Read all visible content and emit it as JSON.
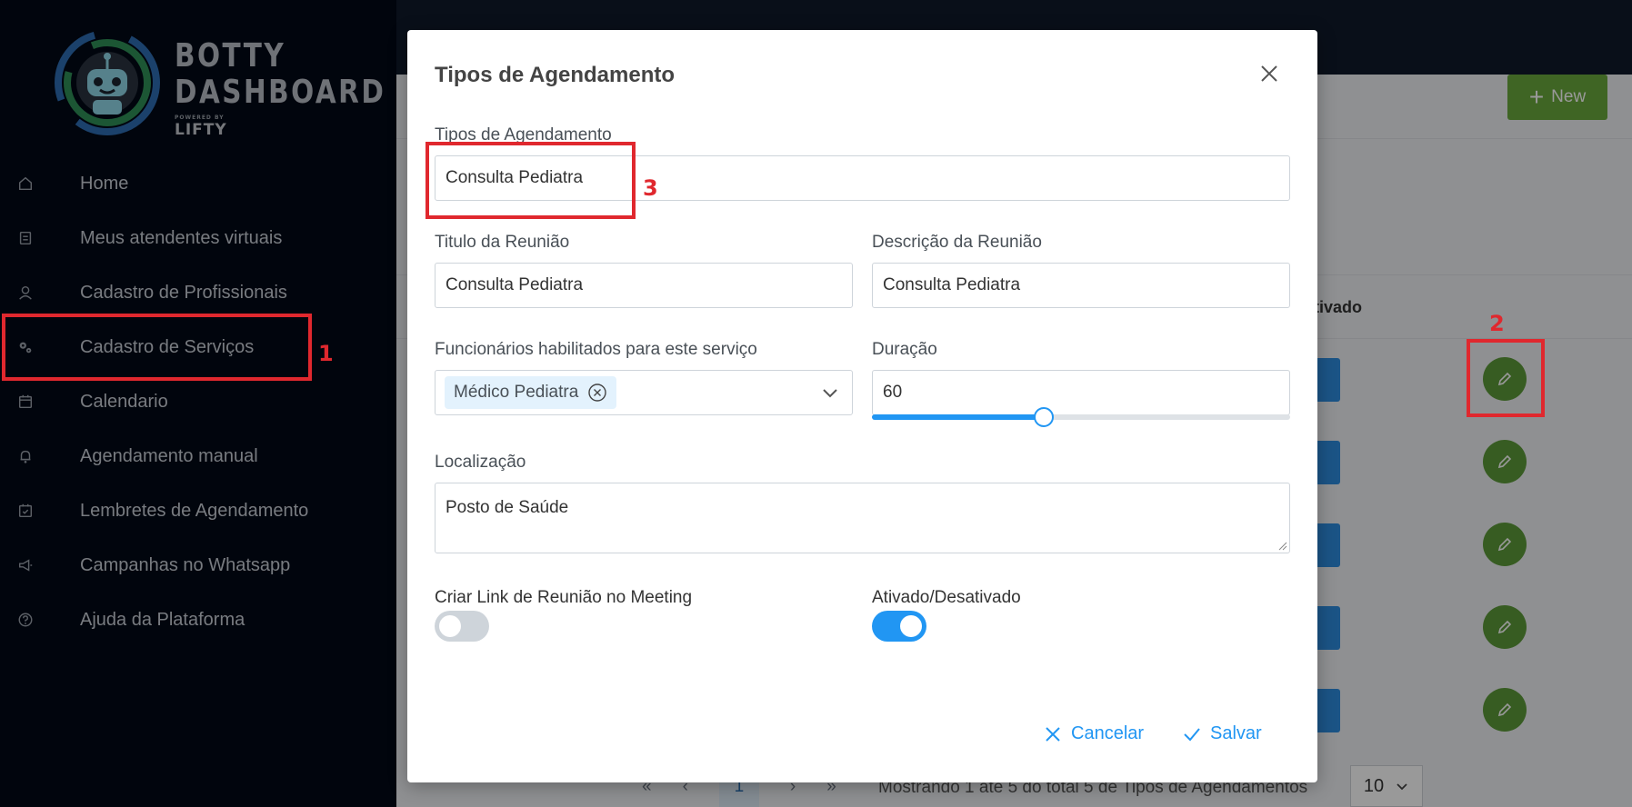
{
  "sidebar": {
    "logo": {
      "line1": "BOTTY",
      "line2": "DASHBOARD",
      "powered": "POWERED BY",
      "brand": "LIFTY"
    },
    "items": [
      {
        "label": "Home",
        "icon": "home-icon"
      },
      {
        "label": "Meus atendentes virtuais",
        "icon": "bot-icon"
      },
      {
        "label": "Cadastro de Profissionais",
        "icon": "user-icon"
      },
      {
        "label": "Cadastro de Serviços",
        "icon": "gears-icon"
      },
      {
        "label": "Calendario",
        "icon": "calendar-icon"
      },
      {
        "label": "Agendamento manual",
        "icon": "bell-icon"
      },
      {
        "label": "Lembretes de Agendamento",
        "icon": "calendar-check-icon"
      },
      {
        "label": "Campanhas no Whatsapp",
        "icon": "megaphone-icon"
      },
      {
        "label": "Ajuda da Plataforma",
        "icon": "help-icon"
      }
    ]
  },
  "main": {
    "new_button": "New",
    "column_header": "tivado",
    "pagination": {
      "first": "«",
      "prev": "‹",
      "page": "1",
      "next": "›",
      "last": "»",
      "info": "Mostrando 1 até 5 do total 5 de Tipos de Agendamentos",
      "per_page": "10"
    }
  },
  "annotations": [
    "1",
    "2",
    "3"
  ],
  "modal": {
    "title": "Tipos de Agendamento",
    "tipo": {
      "label": "Tipos de Agendamento",
      "value": "Consulta Pediatra"
    },
    "titulo": {
      "label": "Titulo da Reunião",
      "value": "Consulta Pediatra"
    },
    "descricao": {
      "label": "Descrição da Reunião",
      "value": "Consulta Pediatra"
    },
    "funcionarios": {
      "label": "Funcionários habilitados para este serviço",
      "selected": [
        "Médico Pediatra"
      ]
    },
    "duracao": {
      "label": "Duração",
      "value": "60",
      "slider_fraction": 0.41
    },
    "localizacao": {
      "label": "Localização",
      "value": "Posto de Saúde"
    },
    "link_meeting": {
      "label": "Criar Link de Reunião no Meeting",
      "enabled": false
    },
    "ativado": {
      "label": "Ativado/Desativado",
      "enabled": true
    },
    "cancel_label": "Cancelar",
    "save_label": "Salvar"
  },
  "colors": {
    "sidebar_bg": "#020916",
    "accent_blue": "#2196f3",
    "edit_green": "#5d9a3a",
    "new_green": "#6aa83c",
    "annotation_red": "#e0282e"
  }
}
